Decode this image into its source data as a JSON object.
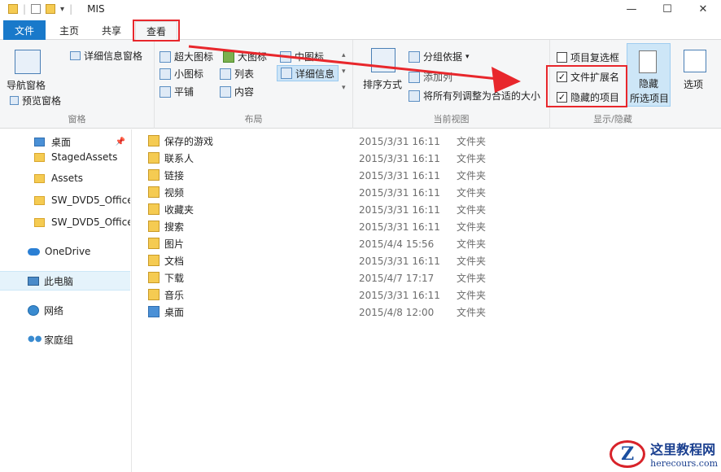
{
  "window": {
    "title": "MIS"
  },
  "tabs": {
    "file": "文件",
    "home": "主页",
    "share": "共享",
    "view": "查看"
  },
  "ribbon": {
    "pane": {
      "nav_pane": "导航窗格",
      "preview_pane": "预览窗格",
      "details_pane": "详细信息窗格",
      "label": "窗格"
    },
    "layout": {
      "extra_large": "超大图标",
      "large": "大图标",
      "medium": "中图标",
      "small": "小图标",
      "list": "列表",
      "details": "详细信息",
      "tiles": "平铺",
      "content": "内容",
      "label": "布局"
    },
    "current_view": {
      "sort_by": "排序方式",
      "group_by": "分组依据",
      "add_columns": "添加列",
      "size_all_columns": "将所有列调整为合适的大小",
      "label": "当前视图"
    },
    "show_hide": {
      "item_checkboxes": "项目复选框",
      "file_extensions": "文件扩展名",
      "hidden_items": "隐藏的项目",
      "hide_selected": "隐藏",
      "hide_selected_2": "所选项目",
      "options": "选项",
      "label": "显示/隐藏"
    }
  },
  "nav": {
    "items": [
      {
        "label": "桌面"
      },
      {
        "label": "StagedAssets"
      },
      {
        "label": "Assets"
      },
      {
        "label": "SW_DVD5_Office"
      },
      {
        "label": "SW_DVD5_Office"
      },
      {
        "label": "OneDrive"
      },
      {
        "label": "此电脑"
      },
      {
        "label": "网络"
      },
      {
        "label": "家庭组"
      }
    ]
  },
  "files": [
    {
      "name": "保存的游戏",
      "date": "2015/3/31 16:11",
      "type": "文件夹"
    },
    {
      "name": "联系人",
      "date": "2015/3/31 16:11",
      "type": "文件夹"
    },
    {
      "name": "链接",
      "date": "2015/3/31 16:11",
      "type": "文件夹"
    },
    {
      "name": "视频",
      "date": "2015/3/31 16:11",
      "type": "文件夹"
    },
    {
      "name": "收藏夹",
      "date": "2015/3/31 16:11",
      "type": "文件夹"
    },
    {
      "name": "搜索",
      "date": "2015/3/31 16:11",
      "type": "文件夹"
    },
    {
      "name": "图片",
      "date": "2015/4/4 15:56",
      "type": "文件夹"
    },
    {
      "name": "文档",
      "date": "2015/3/31 16:11",
      "type": "文件夹"
    },
    {
      "name": "下载",
      "date": "2015/4/7 17:17",
      "type": "文件夹"
    },
    {
      "name": "音乐",
      "date": "2015/3/31 16:11",
      "type": "文件夹"
    },
    {
      "name": "桌面",
      "date": "2015/4/8 12:00",
      "type": "文件夹"
    }
  ],
  "watermark": {
    "cn": "这里教程网",
    "en": "herecours.com"
  },
  "colors": {
    "accent": "#1979ca",
    "highlight_red": "#e8272c"
  }
}
